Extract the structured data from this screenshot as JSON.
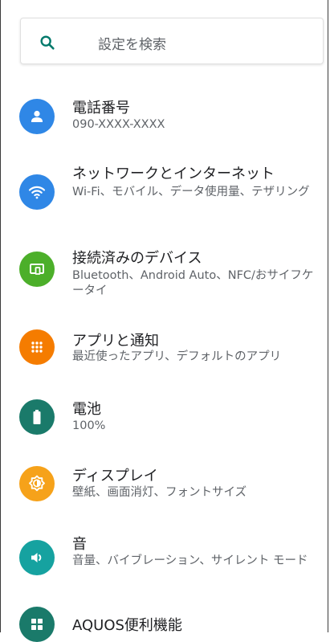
{
  "search": {
    "placeholder": "設定を検索",
    "icon": "search-icon",
    "icon_color": "#00796b"
  },
  "items": [
    {
      "title": "電話番号",
      "subtitle": "090-XXXX-XXXX",
      "icon": "person-icon",
      "color": "#2f87e6"
    },
    {
      "title": "ネットワークとインターネット",
      "subtitle": "Wi-Fi、モバイル、データ使用量、テザリング",
      "icon": "wifi-icon",
      "color": "#2f87e6"
    },
    {
      "title": "接続済みのデバイス",
      "subtitle": "Bluetooth、Android Auto、NFC/おサイフケータイ",
      "icon": "devices-icon",
      "color": "#4caf2a"
    },
    {
      "title": "アプリと通知",
      "subtitle": "最近使ったアプリ、デフォルトのアプリ",
      "icon": "apps-grid-icon",
      "color": "#f57c00"
    },
    {
      "title": "電池",
      "subtitle": "100%",
      "icon": "battery-icon",
      "color": "#1a7a6a"
    },
    {
      "title": "ディスプレイ",
      "subtitle": "壁紙、画面消灯、フォントサイズ",
      "icon": "brightness-icon",
      "color": "#f6a21a"
    },
    {
      "title": "音",
      "subtitle": "音量、バイブレーション、サイレント モード",
      "icon": "volume-icon",
      "color": "#16a2a0"
    },
    {
      "title": "AQUOS便利機能",
      "subtitle": "",
      "icon": "aquos-grid-icon",
      "color": "#1a7a6a"
    }
  ]
}
